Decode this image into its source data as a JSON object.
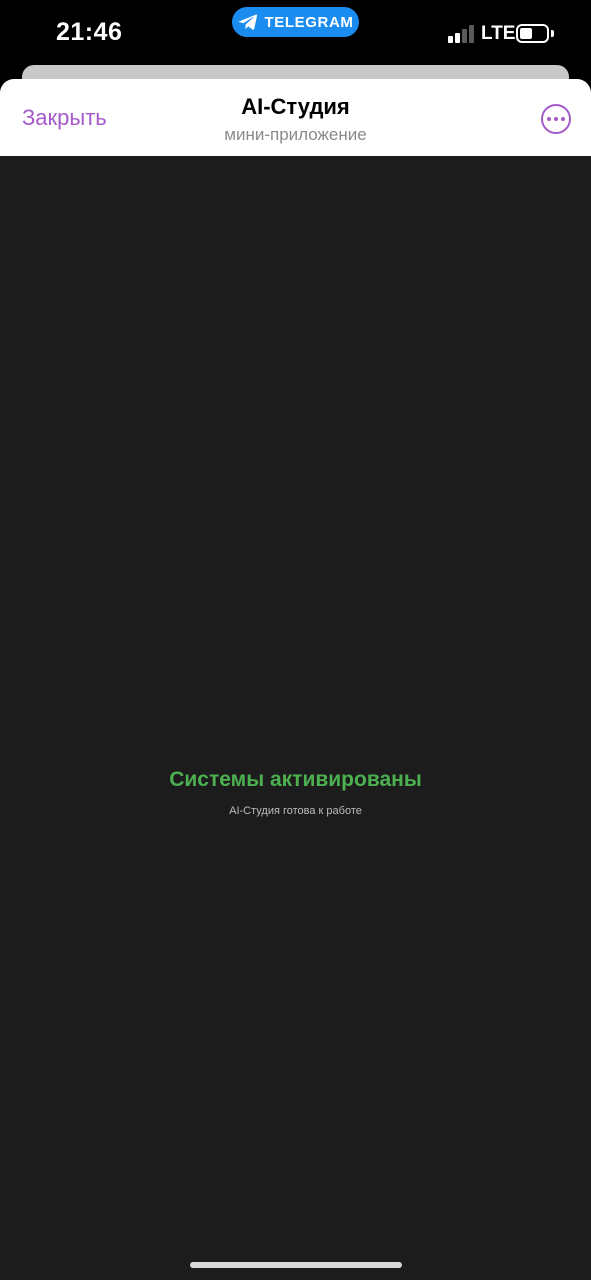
{
  "status_bar": {
    "time": "21:46",
    "pill_label": "TELEGRAM",
    "network": "LTE",
    "pill_color": "#1a8cf0",
    "signal_bars_active": 2,
    "signal_bars_total": 4
  },
  "header": {
    "close_label": "Закрыть",
    "title": "AI-Студия",
    "subtitle": "мини-приложение",
    "accent_color": "#a55ac9"
  },
  "content": {
    "status_title": "Системы активированы",
    "status_subtitle": "AI-Студия готова к работе",
    "status_color": "#4caf50"
  }
}
